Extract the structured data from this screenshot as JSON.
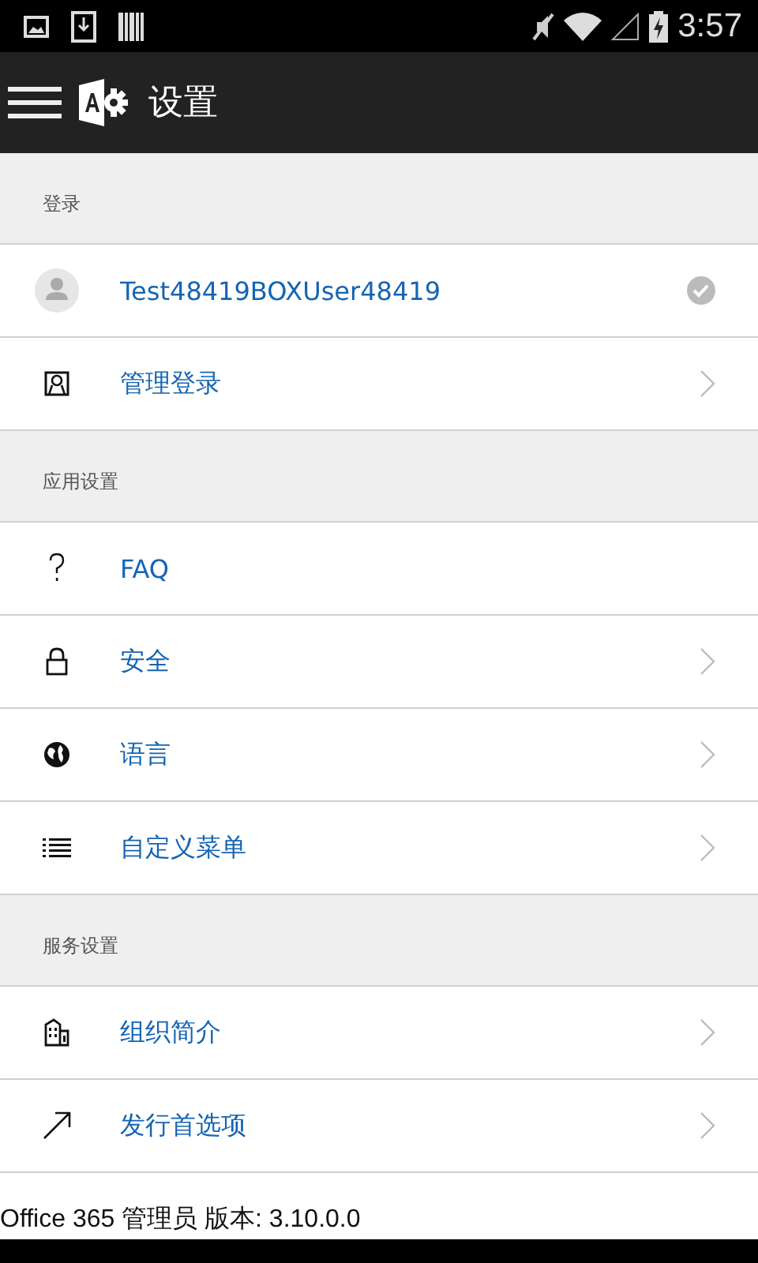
{
  "status_bar": {
    "time": "3:57"
  },
  "app_bar": {
    "title": "设置"
  },
  "sections": [
    {
      "title": "登录",
      "items": [
        {
          "label": "Test48419BOXUser48419",
          "kind": "account"
        },
        {
          "label": "管理登录",
          "kind": "link"
        }
      ]
    },
    {
      "title": "应用设置",
      "items": [
        {
          "label": "FAQ",
          "kind": "plain"
        },
        {
          "label": "安全",
          "kind": "link"
        },
        {
          "label": "语言",
          "kind": "link"
        },
        {
          "label": "自定义菜单",
          "kind": "link"
        }
      ]
    },
    {
      "title": "服务设置",
      "items": [
        {
          "label": "组织简介",
          "kind": "link"
        },
        {
          "label": "发行首选项",
          "kind": "link"
        }
      ]
    }
  ],
  "footer": "Office 365 管理员 版本: 3.10.0.0"
}
